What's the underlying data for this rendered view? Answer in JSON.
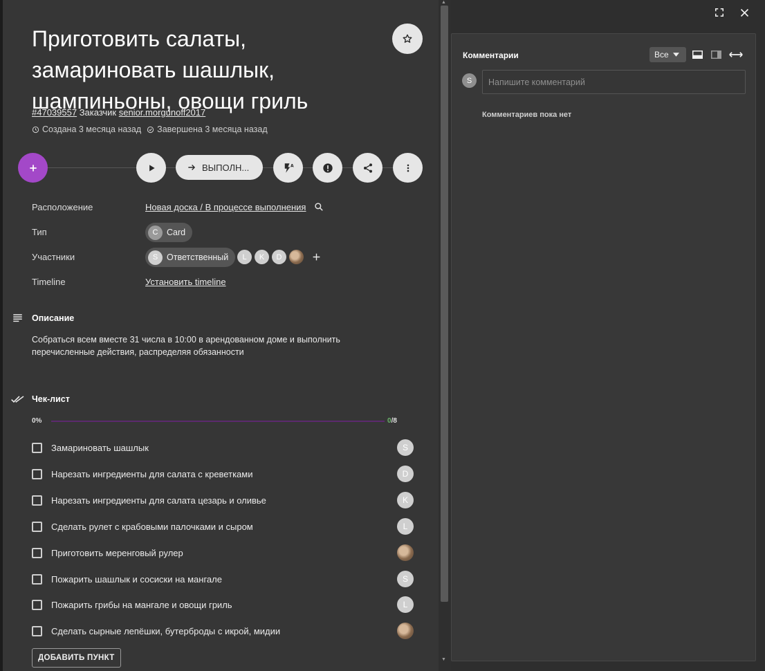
{
  "card": {
    "title": "Приготовить салаты, замариновать шашлык, шампиньоны, овощи гриль",
    "id": "#47039557",
    "customer_label": "Заказчик",
    "customer": "senior.morgunoff2017",
    "created": "Создана 3 месяца назад",
    "completed": "Завершена 3 месяца назад",
    "status_label": "ВЫПОЛН..."
  },
  "props": {
    "location_label": "Расположение",
    "location_value": "Новая доска / В процессе выполнения",
    "type_label": "Тип",
    "type_value": "Card",
    "type_initial": "C",
    "members_label": "Участники",
    "responsible_label": "Ответственный",
    "responsible_initial": "S",
    "members": [
      "L",
      "K",
      "D"
    ],
    "timeline_label": "Timeline",
    "timeline_value": "Установить timeline"
  },
  "description": {
    "heading": "Описание",
    "text": "Собраться всем вместе 31 числа в 10:00 в арендованном доме и выполнить перечисленные действия, распределяя обязанности"
  },
  "checklist": {
    "heading": "Чек-лист",
    "progress_percent": "0%",
    "progress_fraction": 0,
    "done": "0",
    "total": "/8",
    "items": [
      {
        "label": "Замариновать шашлык",
        "assignee": "S"
      },
      {
        "label": "Нарезать ингредиенты для салата с креветками",
        "assignee": "D"
      },
      {
        "label": "Нарезать ингредиенты для салата цезарь и оливье",
        "assignee": "K"
      },
      {
        "label": "Сделать рулет с крабовыми палочками и сыром",
        "assignee": "L"
      },
      {
        "label": "Приготовить меренговый рулер",
        "assignee": ""
      },
      {
        "label": "Пожарить шашлык и сосиски на мангале",
        "assignee": "S"
      },
      {
        "label": "Пожарить грибы на мангале и овощи гриль",
        "assignee": "L"
      },
      {
        "label": "Сделать сырные лепёшки, бутерброды с икрой, мидии",
        "assignee": ""
      }
    ],
    "add_item_label": "ДОБАВИТЬ ПУНКТ"
  },
  "comments": {
    "title": "Комментарии",
    "filter_value": "Все",
    "user_initial": "S",
    "placeholder": "Напишите комментарий",
    "empty_text": "Комментариев пока нет"
  },
  "colors": {
    "accent": "#a348c8",
    "background": "#363636",
    "progress_track": "#5b2a6e"
  }
}
